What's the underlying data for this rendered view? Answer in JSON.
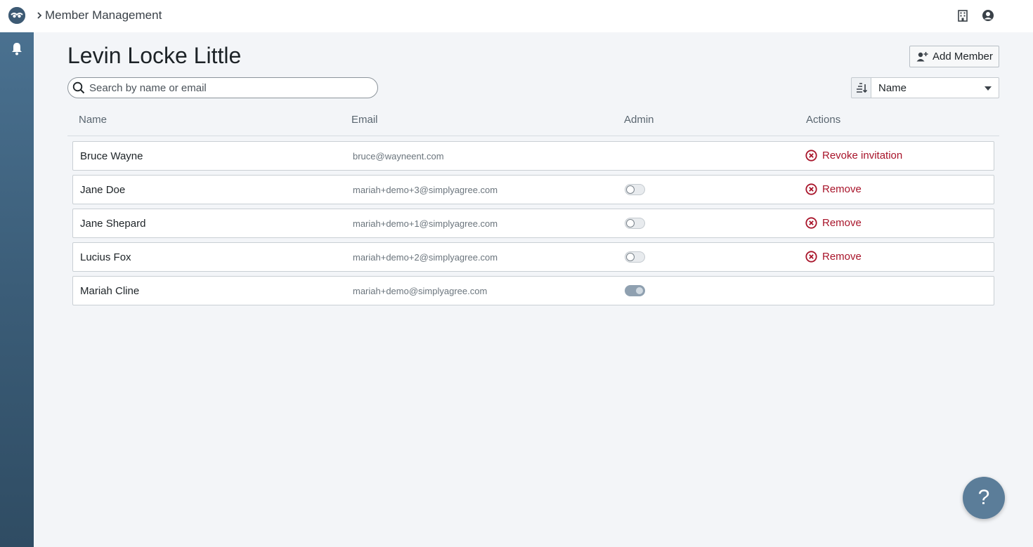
{
  "header": {
    "breadcrumb": "Member Management"
  },
  "page": {
    "title": "Levin Locke Little",
    "add_member_label": "Add Member"
  },
  "search": {
    "placeholder": "Search by name or email",
    "value": ""
  },
  "sort": {
    "selected": "Name"
  },
  "table": {
    "columns": [
      "Name",
      "Email",
      "Admin",
      "Actions"
    ],
    "rows": [
      {
        "name": "Bruce Wayne",
        "email": "bruce@wayneent.com",
        "admin": null,
        "action": "Revoke invitation"
      },
      {
        "name": "Jane Doe",
        "email": "mariah+demo+3@simplyagree.com",
        "admin": false,
        "action": "Remove"
      },
      {
        "name": "Jane Shepard",
        "email": "mariah+demo+1@simplyagree.com",
        "admin": false,
        "action": "Remove"
      },
      {
        "name": "Lucius Fox",
        "email": "mariah+demo+2@simplyagree.com",
        "admin": false,
        "action": "Remove"
      },
      {
        "name": "Mariah Cline",
        "email": "mariah+demo@simplyagree.com",
        "admin": true,
        "action": ""
      }
    ]
  },
  "help": {
    "label": "?"
  },
  "icons": {
    "logo": "brand-logo-icon",
    "breadcrumb_separator": "chevron-right-icon",
    "org": "building-icon",
    "account": "user-circle-icon",
    "notifications": "bell-icon",
    "add_member": "add-user-icon",
    "search": "search-icon",
    "sort": "sort-descending-icon",
    "remove": "circle-x-icon"
  },
  "colors": {
    "sidebar": "#3b5d78",
    "danger": "#a8142a",
    "help_button": "#5b7d99"
  }
}
